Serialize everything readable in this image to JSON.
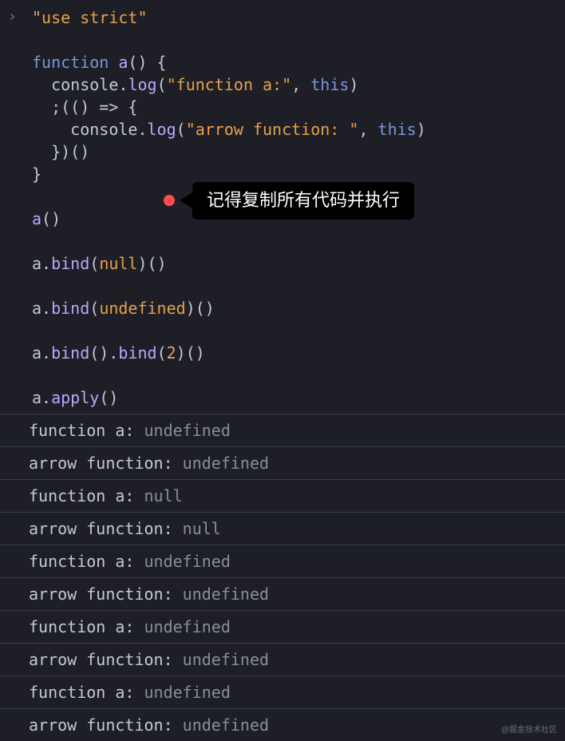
{
  "prompt_glyph": "›",
  "code": {
    "l01_str": "\"use strict\"",
    "l03_kw": "function",
    "l03_fn": "a",
    "l03_rest": "() {",
    "l04_indent": "  ",
    "l04_obj": "console",
    "l04_dot": ".",
    "l04_meth": "log",
    "l04_open": "(",
    "l04_str": "\"function a:\"",
    "l04_comma": ", ",
    "l04_this": "this",
    "l04_close": ")",
    "l05_indent": "  ",
    "l05_start": ";(() => {",
    "l06_indent": "    ",
    "l06_obj": "console",
    "l06_dot": ".",
    "l06_meth": "log",
    "l06_open": "(",
    "l06_str": "\"arrow function: \"",
    "l06_comma": ", ",
    "l06_this": "this",
    "l06_close": ")",
    "l07_indent": "  ",
    "l07_txt": "})()",
    "l08_txt": "}",
    "l10_fn": "a",
    "l10_rest": "()",
    "l12_fn": "a",
    "l12_dot": ".",
    "l12_bind": "bind",
    "l12_open": "(",
    "l12_arg": "null",
    "l12_close": ")()",
    "l14_fn": "a",
    "l14_dot": ".",
    "l14_bind": "bind",
    "l14_open": "(",
    "l14_arg": "undefined",
    "l14_close": ")()",
    "l16_fn": "a",
    "l16_dot1": ".",
    "l16_bind1": "bind",
    "l16_paren1": "()",
    "l16_dot2": ".",
    "l16_bind2": "bind",
    "l16_open": "(",
    "l16_arg": "2",
    "l16_close": ")()",
    "l18_fn": "a",
    "l18_dot": ".",
    "l18_apply": "apply",
    "l18_rest": "()"
  },
  "tooltip": {
    "text": "记得复制所有代码并执行"
  },
  "output": [
    {
      "label": "function a:",
      "value": "undefined"
    },
    {
      "label": "arrow function: ",
      "value": "undefined"
    },
    {
      "label": "function a:",
      "value": "null"
    },
    {
      "label": "arrow function: ",
      "value": "null"
    },
    {
      "label": "function a:",
      "value": "undefined"
    },
    {
      "label": "arrow function: ",
      "value": "undefined"
    },
    {
      "label": "function a:",
      "value": "undefined"
    },
    {
      "label": "arrow function: ",
      "value": "undefined"
    },
    {
      "label": "function a:",
      "value": "undefined"
    },
    {
      "label": "arrow function: ",
      "value": "undefined"
    }
  ],
  "watermark": "@掘金技术社区"
}
